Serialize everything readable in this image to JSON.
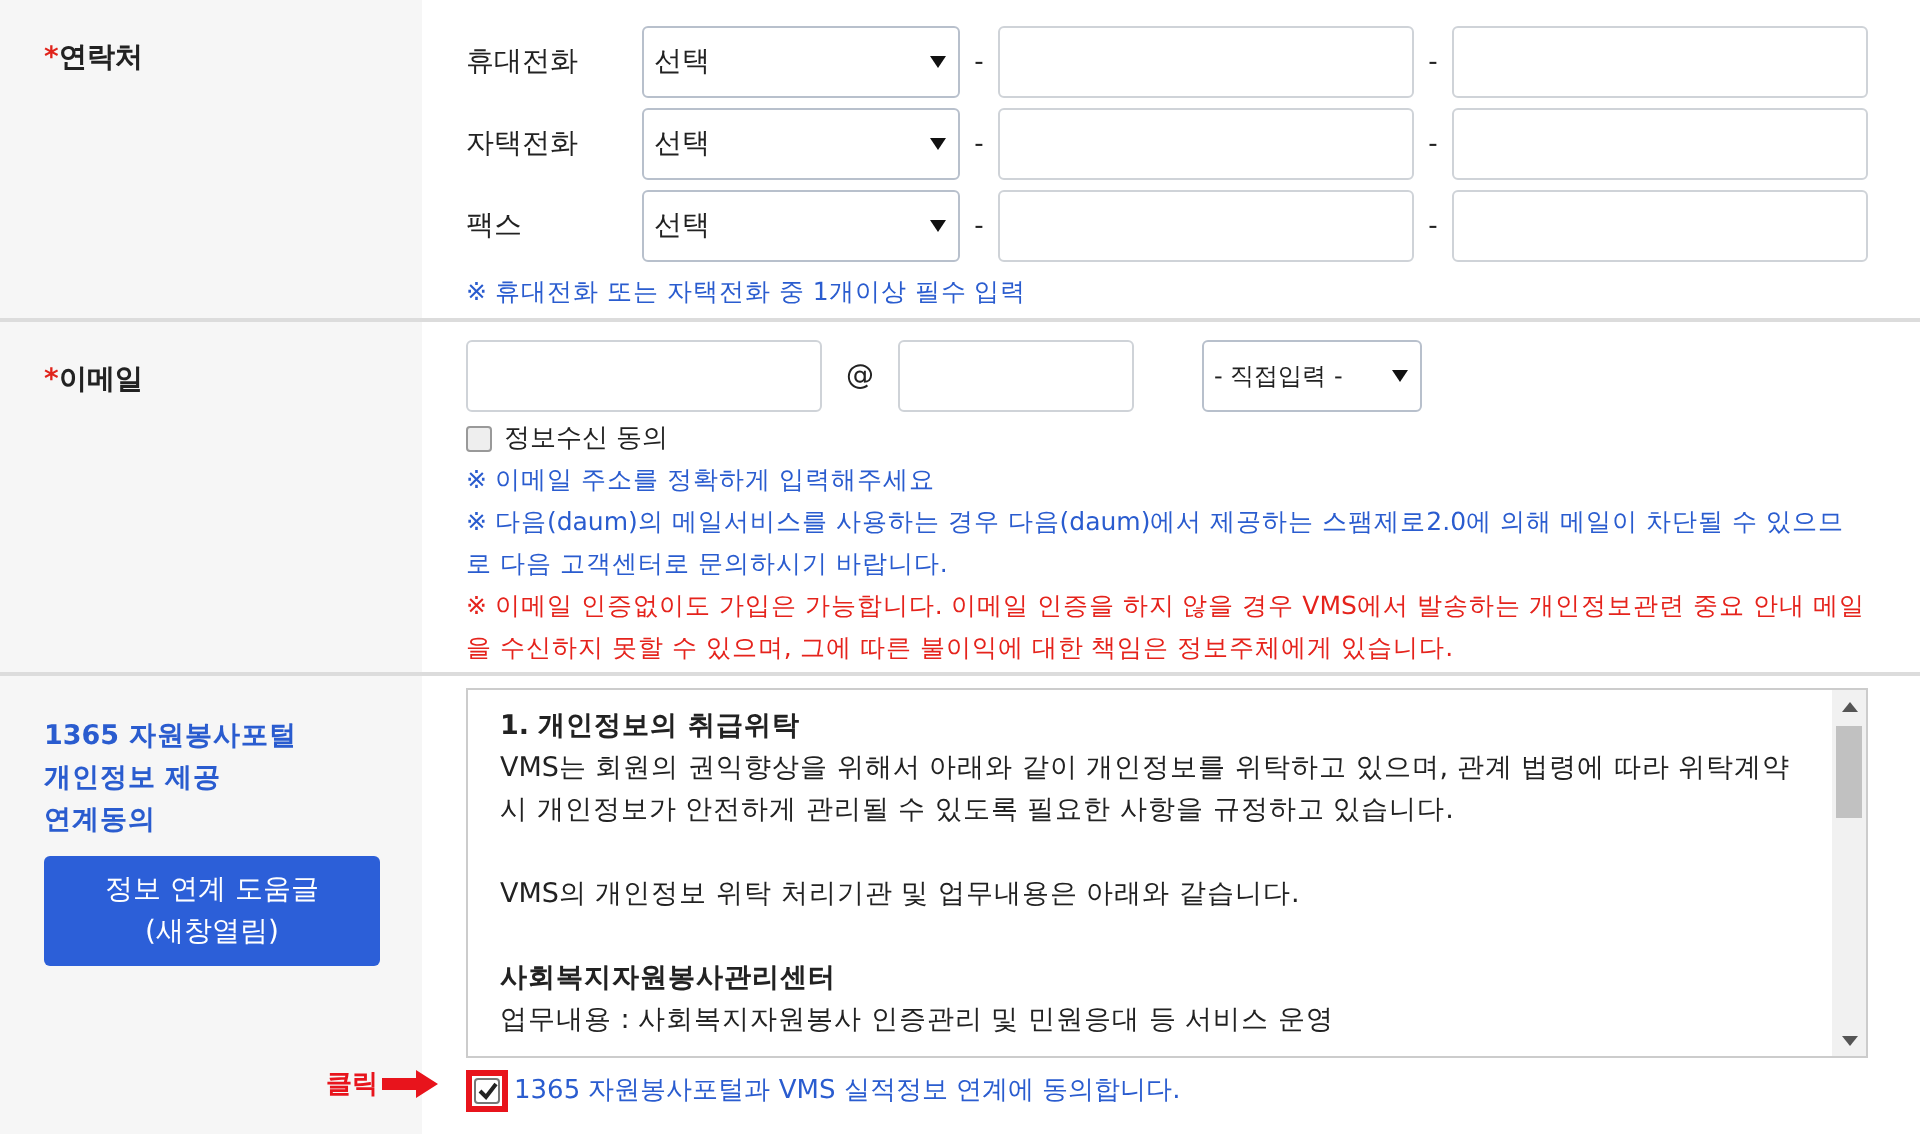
{
  "contact": {
    "required_mark": "*",
    "label": "연락처",
    "phones": [
      {
        "label": "휴대전화",
        "select": "선택",
        "separators": [
          "-",
          "-"
        ]
      },
      {
        "label": "자택전화",
        "select": "선택",
        "separators": [
          "-",
          "-"
        ]
      },
      {
        "label": "팩스",
        "select": "선택",
        "separators": [
          "-",
          "-"
        ]
      }
    ],
    "note": "※ 휴대전화 또는 자택전화 중 1개이상 필수 입력"
  },
  "email": {
    "required_mark": "*",
    "label": "이메일",
    "at": "@",
    "domain_select": "- 직접입력 -",
    "consent": {
      "label": "정보수신 동의",
      "checked": false
    },
    "notes": [
      {
        "kind": "info",
        "text": "※ 이메일 주소를 정확하게 입력해주세요"
      },
      {
        "kind": "info",
        "text": "※ 다음(daum)의 메일서비스를 사용하는 경우 다음(daum)에서 제공하는 스팸제로2.0에 의해 메일이 차단될 수 있으므로 다음 고객센터로 문의하시기 바랍니다."
      },
      {
        "kind": "warning",
        "text": "※ 이메일 인증없이도 가입은 가능합니다. 이메일 인증을 하지 않을 경우 VMS에서 발송하는 개인정보관련 중요 안내 메일을 수신하지 못할 수 있으며, 그에 따른 불이익에 대한 책임은 정보주체에게 있습니다."
      }
    ]
  },
  "link_consent": {
    "label_lines": [
      "1365 자원봉사포털",
      "개인정보 제공",
      "연계동의"
    ],
    "help_button_lines": [
      "정보 연계 도움글",
      "(새창열림)"
    ],
    "terms": [
      {
        "kind": "heading",
        "text": "1. 개인정보의 취급위탁"
      },
      {
        "kind": "text",
        "text": "VMS는 회원의 권익향상을 위해서 아래와 같이 개인정보를 위탁하고 있으며, 관계 법령에 따라 위탁계약시 개인정보가 안전하게 관리될 수 있도록 필요한 사항을 규정하고 있습니다."
      },
      {
        "kind": "gap"
      },
      {
        "kind": "text",
        "text": "VMS의 개인정보 위탁 처리기관 및 업무내용은 아래와 같습니다."
      },
      {
        "kind": "gap"
      },
      {
        "kind": "heading",
        "text": "사회복지자원봉사관리센터"
      },
      {
        "kind": "text",
        "text": "업무내용 : 사회복지자원봉사 인증관리 및 민원응대 등 서비스 운영"
      }
    ],
    "agree": {
      "label": "1365 자원봉사포털과 VMS 실적정보 연계에 동의합니다.",
      "checked": true
    },
    "annotation": "클릭"
  }
}
